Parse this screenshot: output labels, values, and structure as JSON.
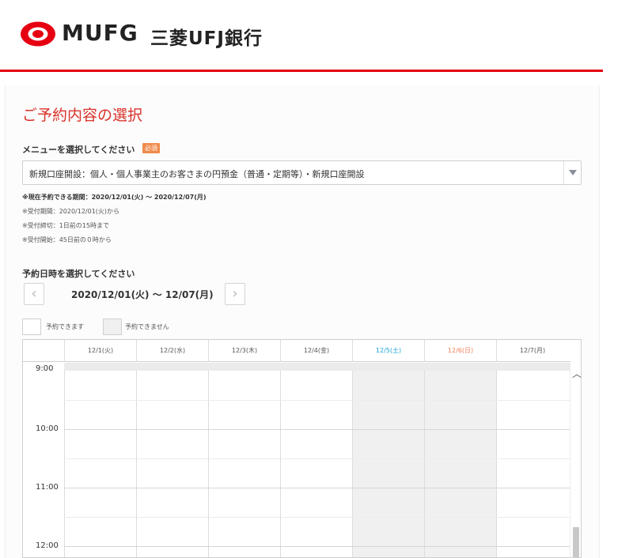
{
  "header": {
    "logo_text": "MUFG",
    "bank_name": "三菱UFJ銀行",
    "brand_color": "#e60012"
  },
  "page": {
    "title": "ご予約内容の選択",
    "menu_label": "メニューを選択してください",
    "required_badge": "必須",
    "menu_select_value": "新規口座開設：個人・個人事業主のお客さまの円預金（普通・定期等）・新規口座開設",
    "notes": {
      "period": "※現在予約できる期間：2020/12/01(火) ～ 2020/12/07(月)",
      "reception": "※受付期間：2020/12/01(火)から",
      "deadline": "※受付締切：1日前の15時まで",
      "start": "※受付開始：45日前の０時から"
    },
    "datetime_label": "予約日時を選択してください",
    "range_label": "2020/12/01(火) ～ 12/07(月)",
    "prev_icon": "chevron-left-icon",
    "next_icon": "chevron-right-icon",
    "legend": {
      "available": "予約できます",
      "unavailable": "予約できません"
    }
  },
  "calendar": {
    "days": [
      "12/1(火)",
      "12/2(水)",
      "12/3(木)",
      "12/4(金)",
      "12/5(土)",
      "12/6(日)",
      "12/7(月)"
    ],
    "times": [
      "9:00",
      "10:00",
      "11:00",
      "12:00"
    ],
    "saturday_color": "#1aa6d8",
    "sunday_color": "#f0805a"
  }
}
